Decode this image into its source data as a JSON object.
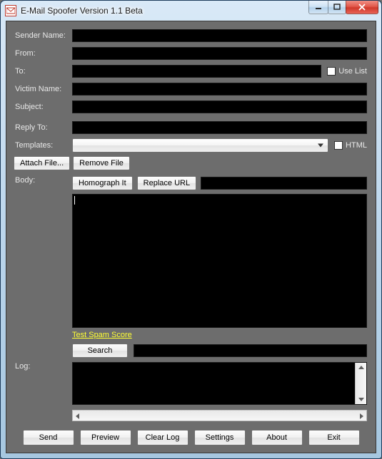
{
  "window": {
    "title": "E-Mail Spoofer Version 1.1 Beta"
  },
  "labels": {
    "senderName": "Sender Name:",
    "from": "From:",
    "to": "To:",
    "victimName": "Victim Name:",
    "subject": "Subject:",
    "replyTo": "Reply To:",
    "templates": "Templates:",
    "body": "Body:",
    "log": "Log:",
    "useList": "Use List",
    "html": "HTML"
  },
  "buttons": {
    "attachFile": "Attach File...",
    "removeFile": "Remove File",
    "homographIt": "Homograph It",
    "replaceUrl": "Replace URL",
    "search": "Search",
    "send": "Send",
    "preview": "Preview",
    "clearLog": "Clear Log",
    "settings": "Settings",
    "about": "About",
    "exit": "Exit"
  },
  "links": {
    "testSpamScore": "Test Spam Score"
  },
  "fields": {
    "senderName": "",
    "from": "",
    "to": "",
    "victimName": "",
    "subject": "",
    "replyTo": "",
    "templatesSelected": "",
    "replaceUrlValue": "",
    "body": "",
    "searchValue": "",
    "log": ""
  },
  "checks": {
    "useList": false,
    "html": false
  }
}
